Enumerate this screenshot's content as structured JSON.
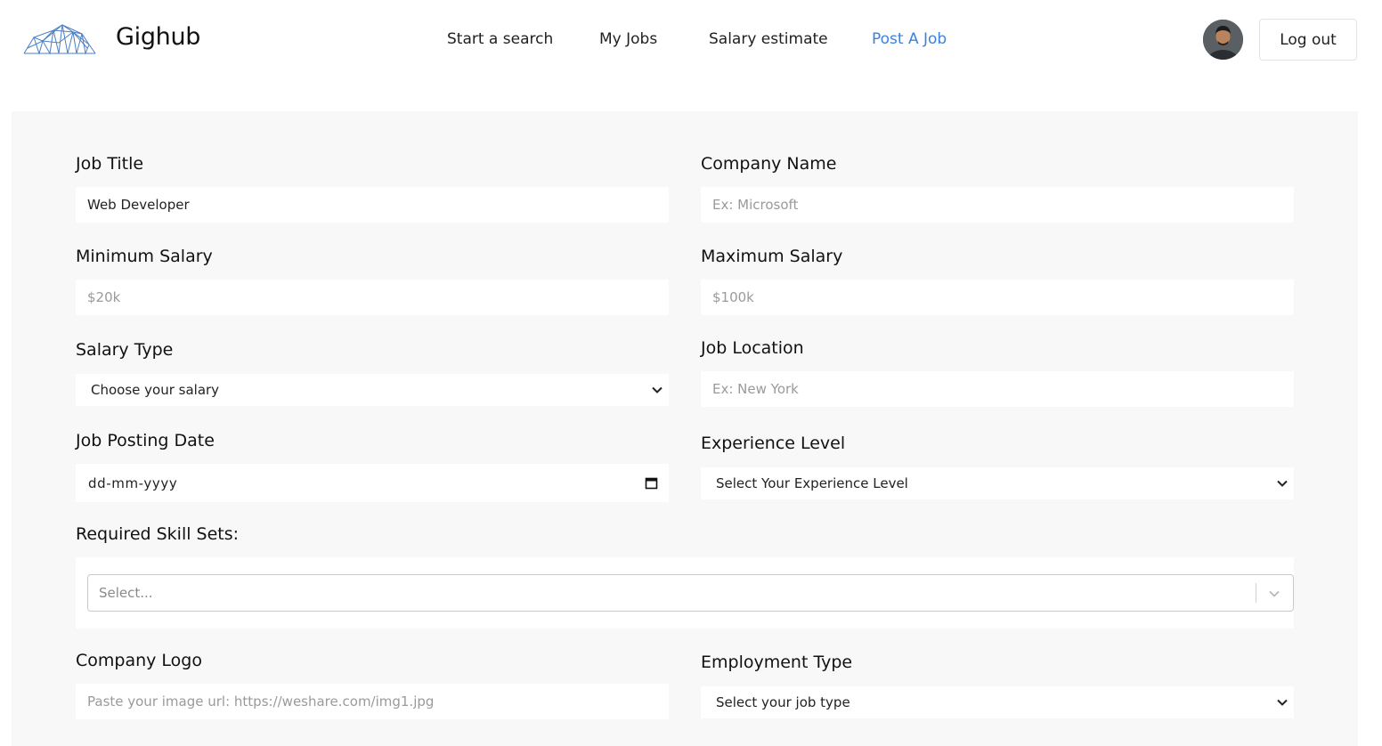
{
  "header": {
    "brand": "Gighub",
    "nav": [
      "Start a search",
      "My Jobs",
      "Salary estimate",
      "Post A Job"
    ],
    "active_nav": "Post A Job",
    "logout_label": "Log out",
    "accent_color": "#3b82dc"
  },
  "form": {
    "job_title": {
      "label": "Job Title",
      "value": "Web Developer"
    },
    "company_name": {
      "label": "Company Name",
      "placeholder": "Ex: Microsoft"
    },
    "min_salary": {
      "label": "Minimum Salary",
      "placeholder": "$20k"
    },
    "max_salary": {
      "label": "Maximum Salary",
      "placeholder": "$100k"
    },
    "salary_type": {
      "label": "Salary Type",
      "selected": "Choose your salary"
    },
    "job_location": {
      "label": "Job Location",
      "placeholder": "Ex: New York"
    },
    "posting_date": {
      "label": "Job Posting Date",
      "value": "dd-mm-yyyy"
    },
    "experience_level": {
      "label": "Experience Level",
      "selected": "Select Your Experience Level"
    },
    "skills": {
      "label": "Required Skill Sets:",
      "placeholder": "Select..."
    },
    "company_logo": {
      "label": "Company Logo",
      "placeholder": "Paste your image url: https://weshare.com/img1.jpg"
    },
    "employment_type": {
      "label": "Employment Type",
      "selected": "Select your job type"
    }
  },
  "icons": {
    "logo": "mountain-wireframe-logo-icon",
    "avatar": "user-avatar",
    "chevron": "chevron-down-icon",
    "calendar": "calendar-icon"
  }
}
